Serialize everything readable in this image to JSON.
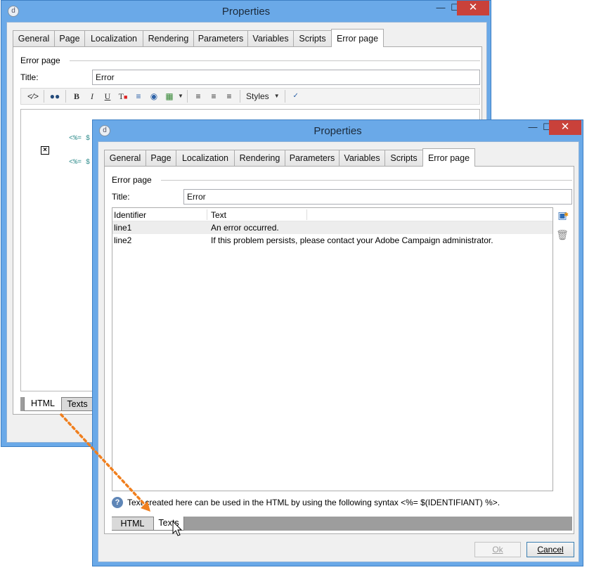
{
  "back_window": {
    "title": "Properties",
    "tabs": [
      "General",
      "Page",
      "Localization",
      "Rendering",
      "Parameters",
      "Variables",
      "Scripts",
      "Error page"
    ],
    "active_tab": "Error page",
    "section_label": "Error page",
    "title_label": "Title:",
    "title_value": "Error",
    "toolbar": {
      "styles_label": "Styles"
    },
    "editor_lines": [
      "<%= $",
      "<%= $"
    ],
    "bottom_tabs": [
      "HTML",
      "Texts"
    ]
  },
  "front_window": {
    "title": "Properties",
    "tabs": [
      "General",
      "Page",
      "Localization",
      "Rendering",
      "Parameters",
      "Variables",
      "Scripts",
      "Error page"
    ],
    "active_tab": "Error page",
    "section_label": "Error page",
    "title_label": "Title:",
    "title_value": "Error",
    "grid": {
      "columns": [
        "Identifier",
        "Text"
      ],
      "rows": [
        {
          "identifier": "line1",
          "text": "An error occurred."
        },
        {
          "identifier": "line2",
          "text": "If this problem persists, please contact your Adobe Campaign administrator."
        }
      ]
    },
    "hint": "Text created here can be used in the HTML by using the following syntax <%= $(IDENTIFIANT) %>.",
    "bottom_tabs": [
      "HTML",
      "Texts"
    ],
    "buttons": {
      "ok": "Ok",
      "cancel": "Cancel"
    }
  },
  "colors": {
    "window_frame": "#6aa9e8",
    "close_button": "#c9413a",
    "arrow": "#f07f1e"
  }
}
